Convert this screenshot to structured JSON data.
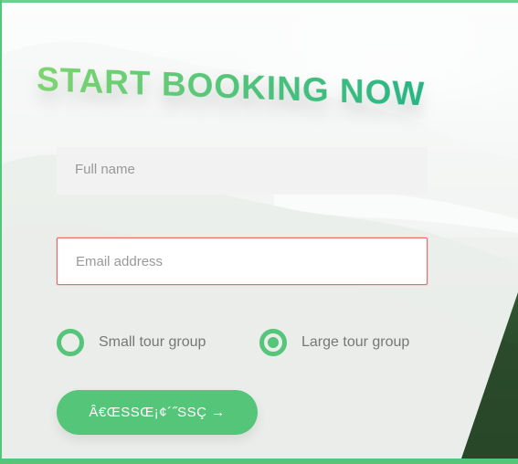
{
  "form": {
    "title": "START BOOKING NOW",
    "full_name": {
      "placeholder": "Full name",
      "value": ""
    },
    "email": {
      "placeholder": "Email address",
      "value": ""
    },
    "radios": [
      {
        "label": "Small tour group",
        "selected": false
      },
      {
        "label": "Large tour group",
        "selected": true
      }
    ],
    "submit_label": "Â€ŒSSŒ¡¢´˝SSÇ →"
  },
  "colors": {
    "accent": "#55c57a",
    "accent_light": "#7ed56f",
    "accent_dark": "#28b485",
    "invalid_border": "#ef6b6b"
  }
}
